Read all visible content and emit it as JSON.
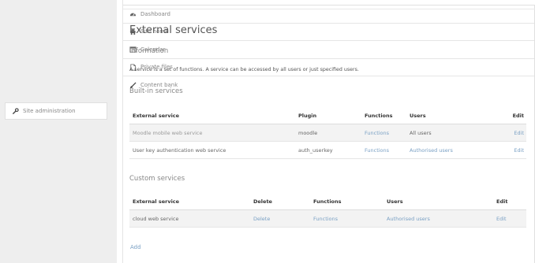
{
  "sidebar": {
    "items": [
      {
        "label": "Dashboard",
        "icon": "dashboard-icon"
      },
      {
        "label": "Site home",
        "icon": "home-icon"
      },
      {
        "label": "Calendar",
        "icon": "calendar-icon"
      },
      {
        "label": "Private files",
        "icon": "file-icon"
      },
      {
        "label": "Content bank",
        "icon": "paint-brush-icon"
      }
    ],
    "admin": {
      "label": "Site administration",
      "icon": "wrench-icon"
    }
  },
  "page": {
    "title": "External services",
    "info_heading": "Information",
    "description": "A service is a set of functions. A service can be accessed by all users or just specified users.",
    "builtin_heading": "Built-in services",
    "custom_heading": "Custom services",
    "add_label": "Add"
  },
  "builtin": {
    "headers": {
      "service": "External service",
      "plugin": "Plugin",
      "functions": "Functions",
      "users": "Users",
      "edit": "Edit"
    },
    "rows": [
      {
        "service": "Moodle mobile web service",
        "plugin": "moodle",
        "functions": "Functions",
        "users": "All users",
        "edit": "Edit"
      },
      {
        "service": "User key authentication web service",
        "plugin": "auth_userkey",
        "functions": "Functions",
        "users": "Authorised users",
        "edit": "Edit"
      }
    ]
  },
  "custom": {
    "headers": {
      "service": "External service",
      "delete": "Delete",
      "functions": "Functions",
      "users": "Users",
      "edit": "Edit"
    },
    "rows": [
      {
        "service": "cloud web service",
        "delete": "Delete",
        "functions": "Functions",
        "users": "Authorised users",
        "edit": "Edit"
      }
    ]
  },
  "colors": {
    "link": "#7aa0c4",
    "sidebar_bg": "#eeeeee",
    "row_alt": "#f3f3f3"
  }
}
